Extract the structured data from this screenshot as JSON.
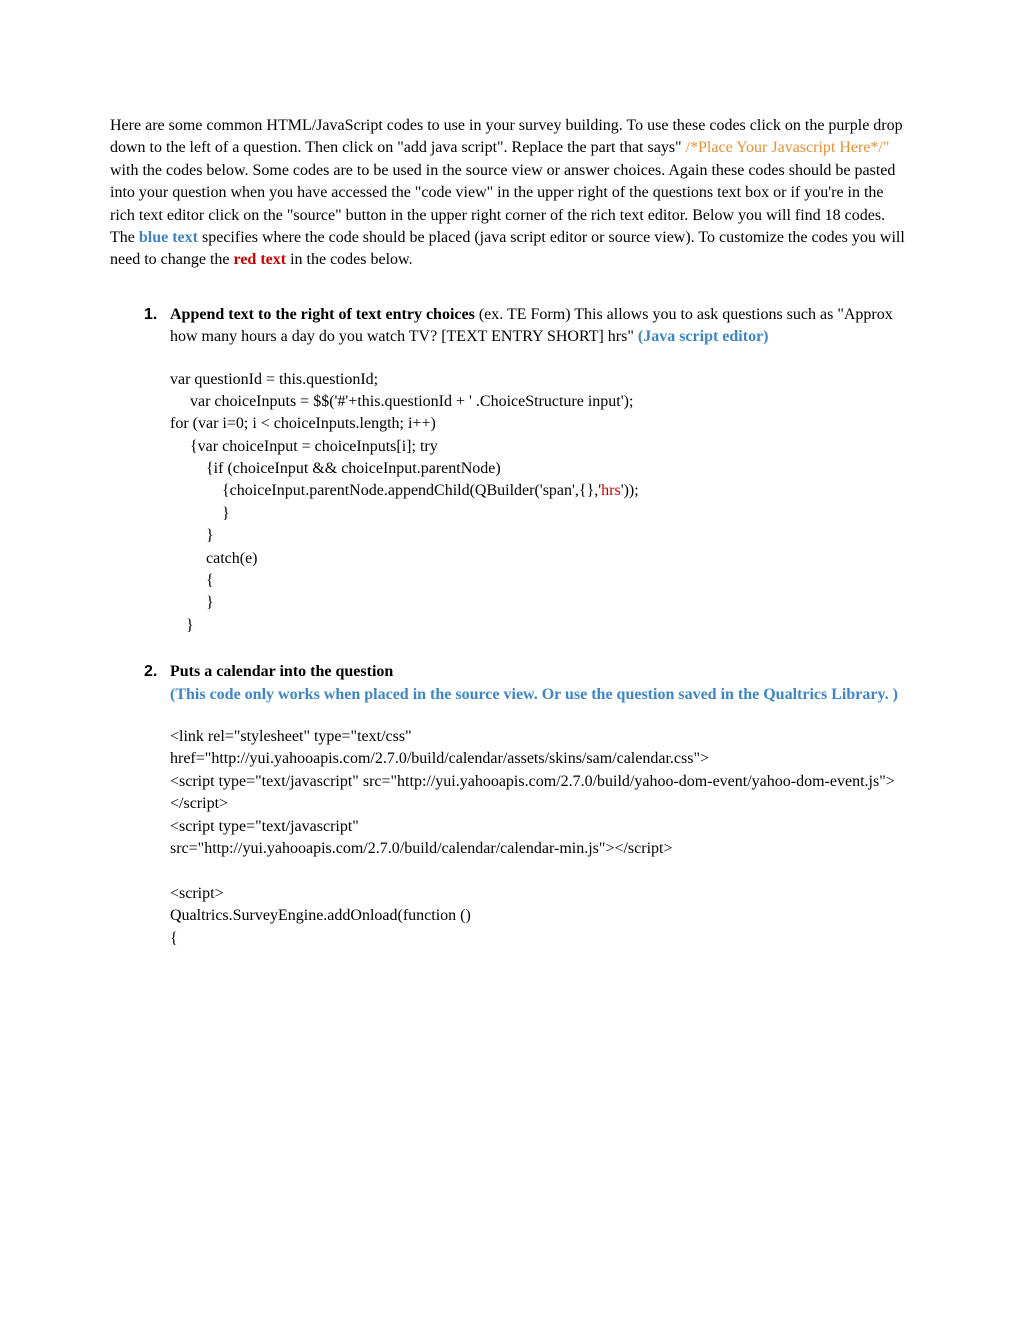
{
  "intro": {
    "p1a": "Here are some common HTML/JavaScript codes to use in your survey building. To use these codes click on the purple drop down to the left of a question. Then click on \"add java script\". Replace the part that says\" ",
    "placeholder": "/*Place Your Javascript Here*/\"",
    "p1b": " with the codes below. Some codes are to be used in the source view or answer choices. Again these codes should be pasted into your question when you have accessed the \"code view\" in the upper right of the questions text box or if you're in the rich text editor click on the \"source\" button in the upper right corner of the rich text editor. Below you will find 18 codes. The ",
    "bluetext": "blue text",
    "p1c": " specifies where the code should be placed (java script editor or source view). To customize the codes you will need to change the ",
    "redtext": "red text",
    "p1d": " in the codes below."
  },
  "item1": {
    "num": "1.",
    "titleBold": "Append text to the right of text entry choices",
    "titleRest": " (ex. TE Form) This allows you to ask questions                                       such as \"Approx how many hours a day do you watch TV? [TEXT ENTRY SHORT] hrs\" ",
    "titleBlue": "(Java script editor)",
    "code": {
      "l1": "var questionId = this.questionId;",
      "l2": "     var choiceInputs = $$('#'+this.questionId + ' .ChoiceStructure input');",
      "l3": "for (var i=0; i < choiceInputs.length; i++)",
      "l4": "     {var choiceInput = choiceInputs[i]; try",
      "l5": "         {if (choiceInput && choiceInput.parentNode)",
      "l6a": "             {choiceInput.parentNode.appendChild(QBuilder('span',{},'",
      "l6red": "hrs",
      "l6b": "'));",
      "l7": "             }",
      "l8": "         }",
      "l9": "         catch(e)",
      "l10": "         {",
      "l11": "         }",
      "l12": "    }"
    }
  },
  "item2": {
    "num": "2.",
    "titleBold": "Puts a calendar into the question",
    "titleBlue": "(This code only works when placed in the source view. Or use the question saved in the Qualtrics Library. )",
    "code": {
      "l1": "<link rel=\"stylesheet\" type=\"text/css\"",
      "l2": "href=\"http://yui.yahooapis.com/2.7.0/build/calendar/assets/skins/sam/calendar.css\">",
      "l3": "<script type=\"text/javascript\" src=\"http://yui.yahooapis.com/2.7.0/build/yahoo-dom-event/yahoo-dom-event.js\"></script>",
      "l4": "<script type=\"text/javascript\"",
      "l5": "src=\"http://yui.yahooapis.com/2.7.0/build/calendar/calendar-min.js\"></script>",
      "l6": "",
      "l7": "<script>",
      "l8": "Qualtrics.SurveyEngine.addOnload(function ()",
      "l9": "{"
    }
  }
}
